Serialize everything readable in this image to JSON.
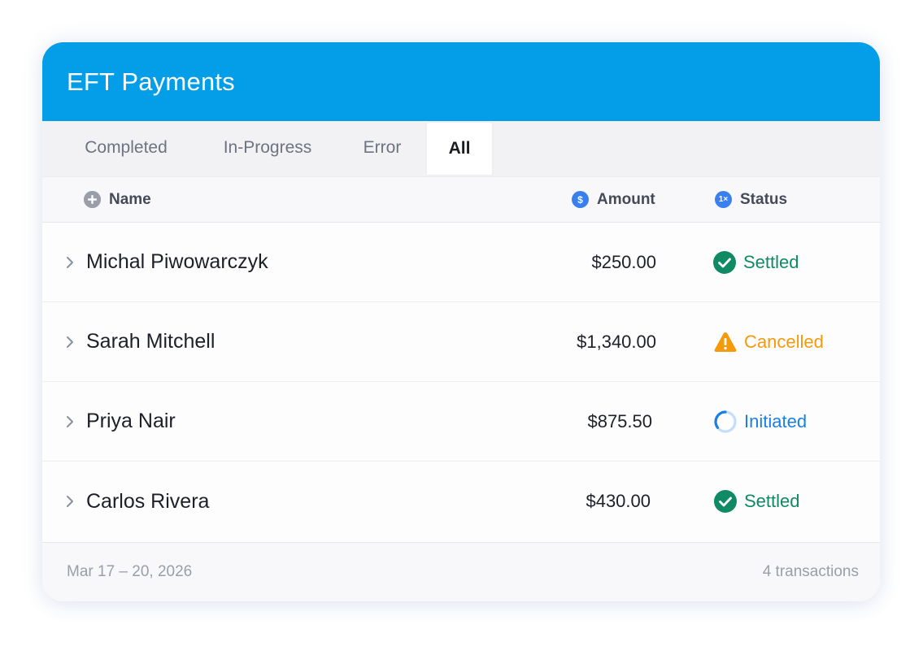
{
  "title": "EFT Payments",
  "tabs": [
    {
      "label": "Completed",
      "active": false
    },
    {
      "label": "In-Progress",
      "active": false
    },
    {
      "label": "Error",
      "active": false
    },
    {
      "label": "All",
      "active": true
    }
  ],
  "columns": {
    "name": {
      "label": "Name",
      "icon": "plus-circle-icon"
    },
    "amount": {
      "label": "Amount",
      "icon": "dollar-circle-icon",
      "icon_text": "$"
    },
    "status": {
      "label": "Status",
      "icon": "status-count-icon",
      "icon_text": "1×"
    }
  },
  "rows": [
    {
      "name": "Michal Piwowarczyk",
      "amount": "$250.00",
      "status": "Settled",
      "status_icon": "check-circle-icon"
    },
    {
      "name": "Sarah Mitchell",
      "amount": "$1,340.00",
      "status": "Cancelled",
      "status_icon": "warning-triangle-icon"
    },
    {
      "name": "Priya Nair",
      "amount": "$875.50",
      "status": "Initiated",
      "status_icon": "spinner-ring-icon"
    },
    {
      "name": "Carlos Rivera",
      "amount": "$430.00",
      "status": "Settled",
      "status_icon": "check-circle-icon"
    }
  ],
  "footer": {
    "date_range": "Mar 17 – 20, 2026",
    "count": "4 transactions"
  },
  "colors": {
    "header": "#039de8",
    "settled": "#0f8a63",
    "cancelled": "#f59a0b",
    "initiated": "#1a7fe0",
    "column_icon_blue": "#3a7ff0",
    "plus_icon_gray": "#9a9ea8"
  }
}
